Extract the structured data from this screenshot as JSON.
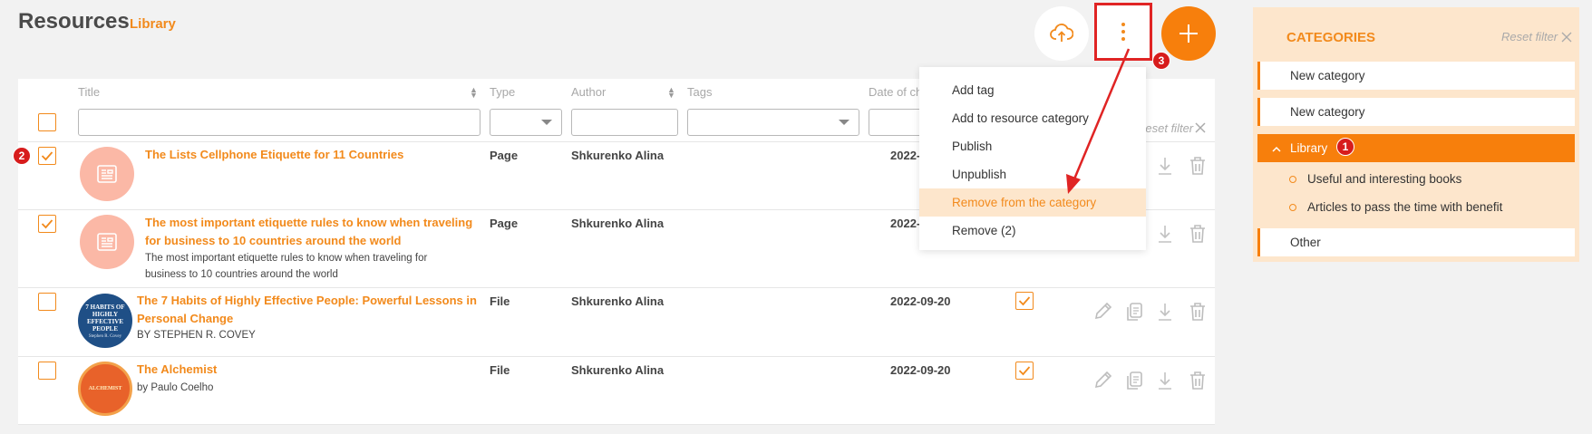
{
  "header": {
    "title": "Resources",
    "subtitle": "Library"
  },
  "table": {
    "columns": {
      "title": "Title",
      "type": "Type",
      "author": "Author",
      "tags": "Tags",
      "date": "Date of ch"
    },
    "reset_filter": "Reset filter",
    "rows": [
      {
        "title": "The Lists Cellphone Etiquette for 11 Countries",
        "title2": "",
        "desc": "",
        "desc2": "",
        "type": "Page",
        "author": "Shkurenko Alina",
        "date": "2022-",
        "checked": true
      },
      {
        "title": "The most important etiquette rules to know when traveling",
        "title2": "for business to 10 countries around the world",
        "desc": "The most important etiquette rules to know when traveling for",
        "desc2": "business to 10 countries around the world",
        "type": "Page",
        "author": "Shkurenko Alina",
        "date": "2022-",
        "checked": true
      },
      {
        "title": "The 7 Habits of Highly Effective People: Powerful Lessons in",
        "title2": "Personal Change",
        "desc": "BY STEPHEN R. COVEY",
        "desc2": "",
        "type": "File",
        "author": "Shkurenko Alina",
        "date": "2022-09-20",
        "checked": false
      },
      {
        "title": "The Alchemist",
        "title2": "",
        "desc": "by Paulo Coelho",
        "desc2": "",
        "type": "File",
        "author": "Shkurenko Alina",
        "date": "2022-09-20",
        "checked": false
      }
    ]
  },
  "menu": {
    "items": [
      "Add tag",
      "Add to resource category",
      "Publish",
      "Unpublish",
      "Remove from the category",
      "Remove (2)"
    ],
    "active_index": 4
  },
  "panel": {
    "title": "CATEGORIES",
    "reset": "Reset filter",
    "categories": [
      "New category",
      "New category",
      "Library",
      "Other"
    ],
    "subcategories": [
      "Useful and interesting books",
      "Articles to pass the time with benefit"
    ]
  },
  "badges": [
    "1",
    "2",
    "3"
  ],
  "book_covers": {
    "covey": "7 HABITS OF HIGHLY EFFECTIVE PEOPLE",
    "covey_author": "Stephen R. Covey",
    "alchemist": "ALCHEMIST"
  },
  "colors": {
    "accent": "#f77f0c",
    "accent_text": "#f28a1c",
    "panel_bg": "#fde6cc",
    "highlight": "#e02424"
  }
}
